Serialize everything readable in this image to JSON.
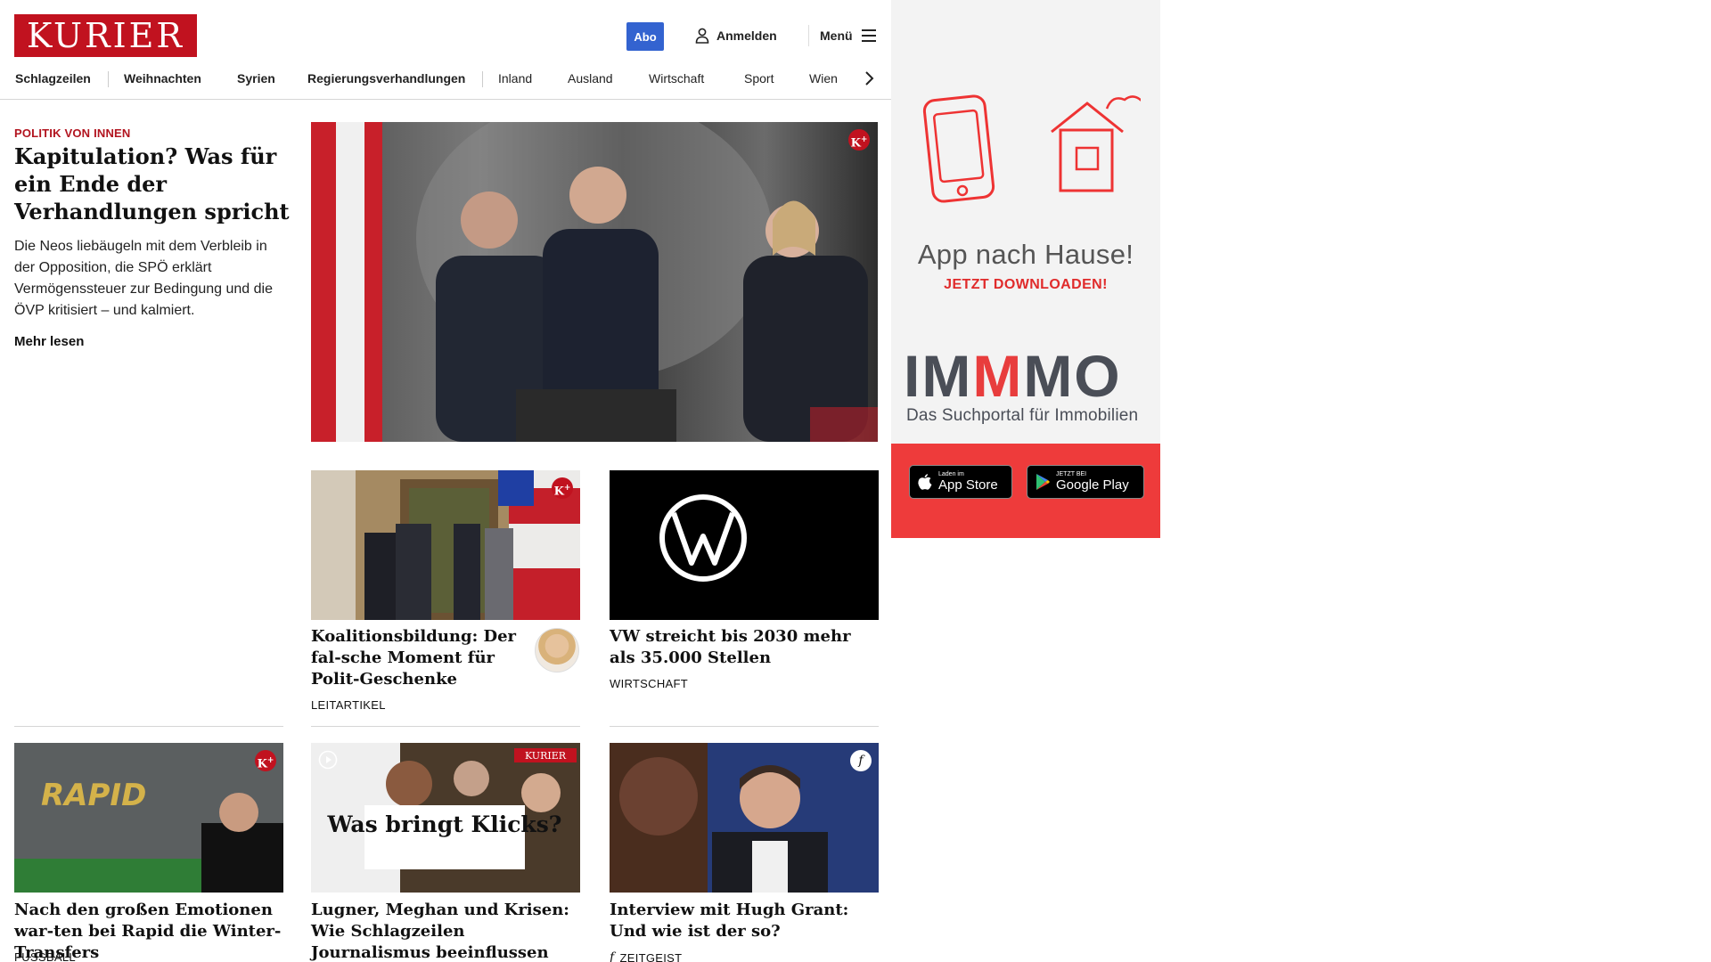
{
  "header": {
    "logo": "KURIER",
    "abo_label": "Abo",
    "login_label": "Anmelden",
    "menu_label": "Menü"
  },
  "nav": {
    "items": [
      "Schlagzeilen",
      "Weihnachten",
      "Syrien",
      "Regierungsverhandlungen",
      "Inland",
      "Ausland",
      "Wirtschaft",
      "Sport",
      "Wien"
    ]
  },
  "lead": {
    "kicker": "POLITIK VON INNEN",
    "title": "Kapitulation? Was für ein Ende der Verhandlungen spricht",
    "text": "Die Neos liebäugeln mit dem Verbleib in der Opposition, die SPÖ erklärt Vermögenssteuer zur Bedingung und die ÖVP kritisiert – und kalmiert.",
    "more": "Mehr lesen"
  },
  "cards": [
    {
      "title": "Koalitionsbildung: Der fal-sche Moment für Polit-Geschenke",
      "tag": "LEITARTIKEL"
    },
    {
      "title": "VW streicht bis 2030 mehr als 35.000 Stellen",
      "tag": "WIRTSCHAFT",
      "image_text": "VW"
    },
    {
      "title": "Nach den großen Emotionen war-ten bei Rapid die Winter-Transfers",
      "tag": "FUSSBALL",
      "image_text": "RAPID"
    },
    {
      "title": "Lugner, Meghan und Krisen: Wie Schlagzeilen Journalismus beeinflussen",
      "tag": "",
      "image_text": "Was bringt Klicks?",
      "image_brand": "KURIER"
    },
    {
      "title": "Interview mit Hugh Grant: Und wie ist der so?",
      "tag": "ZEITGEIST"
    }
  ],
  "ad": {
    "app_title": "App nach Hause!",
    "app_sub": "JETZT DOWNLOADEN!",
    "immo_logo": [
      "IM",
      "M",
      "MO"
    ],
    "immo_sub": "Das Suchportal für Immobilien",
    "appstore_small": "Laden im",
    "appstore_big": "App Store",
    "play_small": "JETZT BEI",
    "play_big": "Google Play"
  },
  "colors": {
    "brand": "#c1121f",
    "abo": "#3363d0",
    "ad_band": "#ee3b3b"
  }
}
